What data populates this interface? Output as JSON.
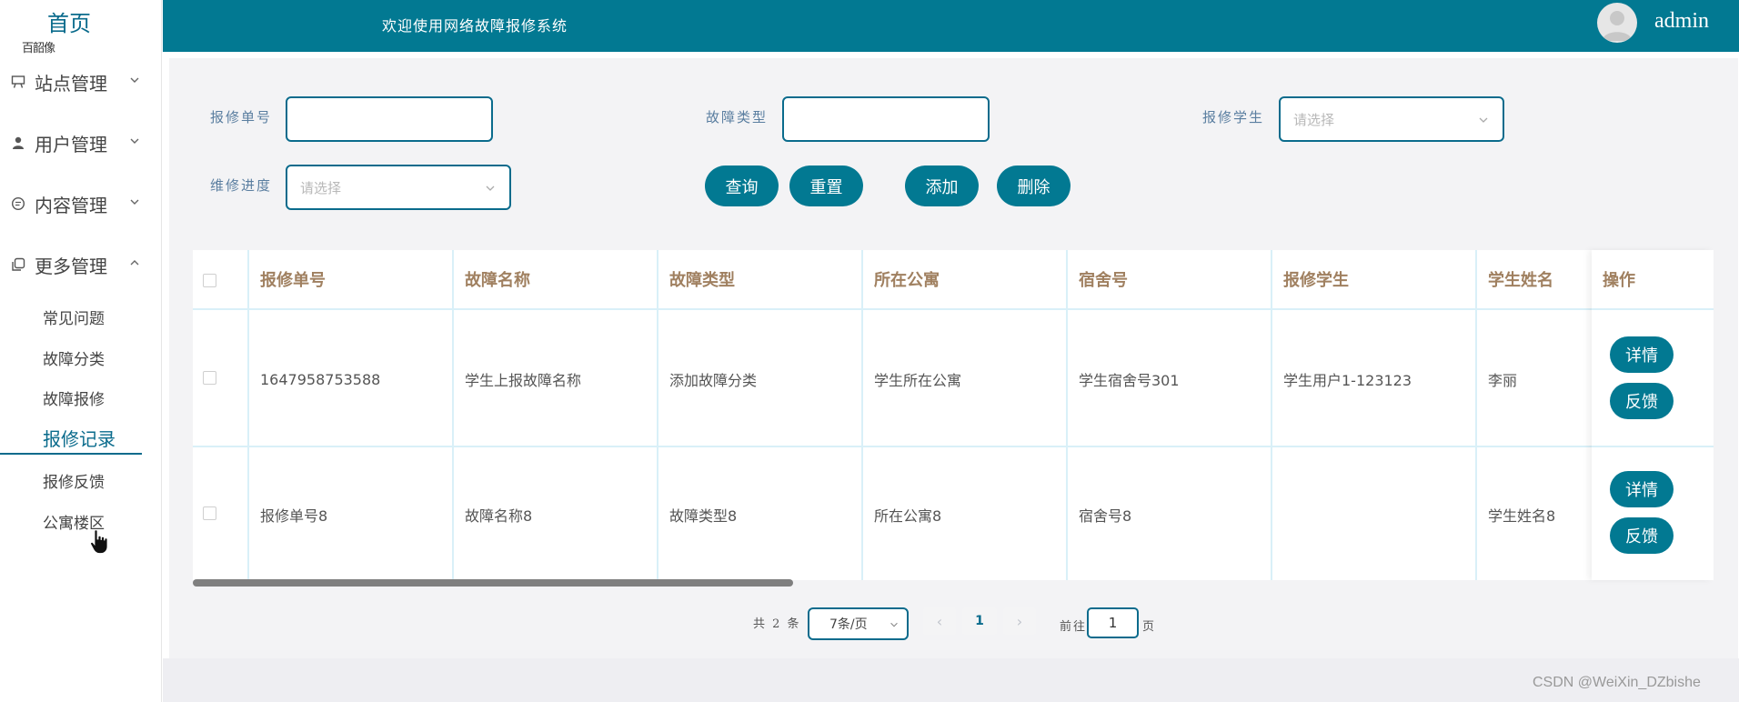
{
  "sidebar": {
    "home_title": "首页",
    "home_sub": "百韶像",
    "groups": [
      {
        "label": "站点管理",
        "icon": "easel-icon"
      },
      {
        "label": "用户管理",
        "icon": "user-icon"
      },
      {
        "label": "内容管理",
        "icon": "chat-icon"
      },
      {
        "label": "更多管理",
        "icon": "copy-icon"
      }
    ],
    "sub_items": [
      "常见问题",
      "故障分类",
      "故障报修",
      "报修记录",
      "报修反馈",
      "公寓楼区"
    ],
    "active_item": "报修记录"
  },
  "header": {
    "welcome": "欢迎使用网络故障报修系统",
    "user": "admin"
  },
  "filters": {
    "order_no_label": "报修单号",
    "order_no_value": "",
    "fault_type_label": "故障类型",
    "fault_type_value": "",
    "student_label": "报修学生",
    "student_placeholder": "请选择",
    "progress_label": "维修进度",
    "progress_placeholder": "请选择"
  },
  "actions": {
    "query": "查询",
    "reset": "重置",
    "add": "添加",
    "delete": "删除"
  },
  "table": {
    "columns": [
      "报修单号",
      "故障名称",
      "故障类型",
      "所在公寓",
      "宿舍号",
      "报修学生",
      "学生姓名"
    ],
    "operation_header": "操作",
    "rows": [
      {
        "cells": [
          "1647958753588",
          "学生上报故障名称",
          "添加故障分类",
          "学生所在公寓",
          "学生宿舍号301",
          "学生用户1-123123",
          "李丽"
        ]
      },
      {
        "cells": [
          "报修单号8",
          "故障名称8",
          "故障类型8",
          "所在公寓8",
          "宿舍号8",
          "",
          "学生姓名8"
        ]
      }
    ],
    "detail_label": "详情",
    "feedback_label": "反馈"
  },
  "pagination": {
    "total_text": "共 2 条",
    "page_size": "7条/页",
    "prev": "‹",
    "current_page": "1",
    "next": "›",
    "goto_label": "前往",
    "goto_value": "1",
    "page_suffix": "页"
  },
  "watermark": "CSDN @WeiXin_DZbishe",
  "colors": {
    "primary": "#027992",
    "accent_text": "#0a6b8c",
    "header_text": "#a08060"
  }
}
